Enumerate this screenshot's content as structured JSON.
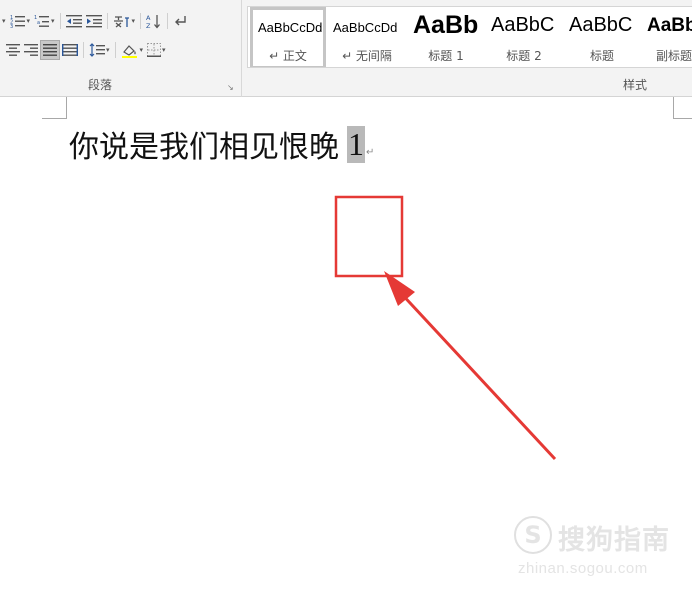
{
  "ribbon": {
    "paragraph_group": {
      "label": "段落",
      "launcher_glyph": "↘",
      "row1": [
        "bullets-icon",
        "numbering-icon",
        "multilevel-list-icon",
        "decrease-indent-icon",
        "increase-indent-icon",
        "asian-layout-icon",
        "sort-icon",
        "show-marks-icon"
      ],
      "row2": [
        "align-left-icon",
        "align-center-icon",
        "align-right-icon",
        "justify-icon",
        "distributed-icon",
        "line-spacing-icon",
        "shading-icon",
        "borders-icon"
      ]
    },
    "styles_group": {
      "label": "样式",
      "items": [
        {
          "sample": "AaBbCcDd",
          "name": "↵ 正文",
          "selected": true
        },
        {
          "sample": "AaBbCcDd",
          "name": "↵ 无间隔",
          "selected": false
        },
        {
          "sample": "AaBb",
          "name": "标题 1",
          "selected": false
        },
        {
          "sample": "AaBbC",
          "name": "标题 2",
          "selected": false
        },
        {
          "sample": "AaBbC",
          "name": "标题",
          "selected": false
        },
        {
          "sample": "AaBb",
          "name": "副标题",
          "selected": false
        }
      ]
    }
  },
  "document": {
    "text": "你说是我们相见恨晚",
    "selected_text": "1",
    "paragraph_mark": "↵"
  },
  "annotation": {
    "highlight_color": "#e53935",
    "arrow_color": "#e53935"
  },
  "watermark": {
    "logo_glyph": "S",
    "brand": "搜狗指南",
    "url": "zhinan.sogou.com"
  }
}
